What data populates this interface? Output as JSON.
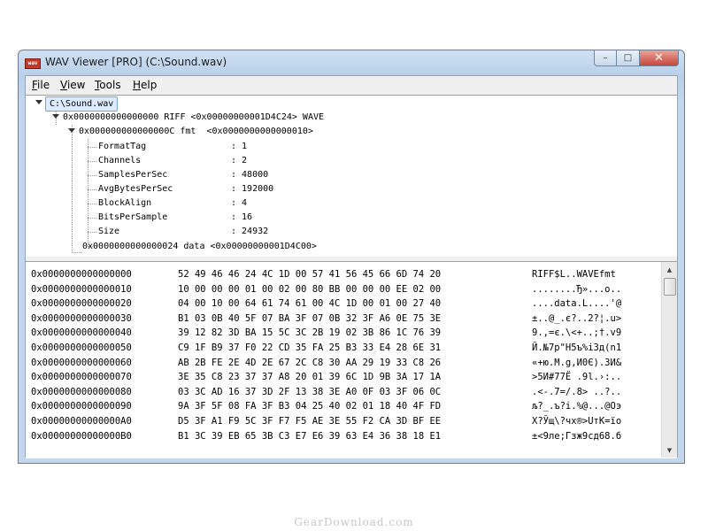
{
  "window": {
    "title": "WAV Viewer [PRO] (C:\\Sound.wav)",
    "app_icon_text": "wav",
    "controls": {
      "minimize": "–",
      "maximize": "□",
      "close": "✕"
    }
  },
  "menu": {
    "file": "File",
    "view": "View",
    "tools": "Tools",
    "help": "Help"
  },
  "tree": {
    "root": "C:\\Sound.wav",
    "riff": "0x0000000000000000 RIFF <0x00000000001D4C24> WAVE",
    "fmt": "0x000000000000000C fmt  <0x0000000000000010>",
    "fields": [
      {
        "name": "FormatTag",
        "value": ": 1"
      },
      {
        "name": "Channels",
        "value": ": 2"
      },
      {
        "name": "SamplesPerSec",
        "value": ": 48000"
      },
      {
        "name": "AvgBytesPerSec",
        "value": ": 192000"
      },
      {
        "name": "BlockAlign",
        "value": ": 4"
      },
      {
        "name": "BitsPerSample",
        "value": ": 16"
      },
      {
        "name": "Size",
        "value": ": 24932"
      }
    ],
    "data": "0x0000000000000024 data <0x00000000001D4C00>"
  },
  "hex_rows": [
    {
      "offset": "0x0000000000000000",
      "bytes": "52 49 46 46 24 4C 1D 00 57 41 56 45 66 6D 74 20",
      "ascii": "RIFF$L..WAVEfmt"
    },
    {
      "offset": "0x0000000000000010",
      "bytes": "10 00 00 00 01 00 02 00 80 BB 00 00 00 EE 02 00",
      "ascii": "........Ђ»...о.."
    },
    {
      "offset": "0x0000000000000020",
      "bytes": "04 00 10 00 64 61 74 61 00 4C 1D 00 01 00 27 40",
      "ascii": "....data.L....'@"
    },
    {
      "offset": "0x0000000000000030",
      "bytes": "B1 03 0B 40 5F 07 BA 3F 07 0B 32 3F A6 0E 75 3E",
      "ascii": "±..@_.є?..2?¦.u>"
    },
    {
      "offset": "0x0000000000000040",
      "bytes": "39 12 82 3D BA 15 5C 3C 2B 19 02 3B 86 1C 76 39",
      "ascii": "9.‚=є.\\<+..;†.v9"
    },
    {
      "offset": "0x0000000000000050",
      "bytes": "C9 1F B9 37 F0 22 CD 35 FA 25 B3 33 E4 28 6E 31",
      "ascii": "Й.№7р\"Н5ъ%і3д(n1"
    },
    {
      "offset": "0x0000000000000060",
      "bytes": "AB 2B FE 2E 4D 2E 67 2C C8 30 AA 29 19 33 C8 26",
      "ascii": "«+ю.M.g,И0Є).3И&"
    },
    {
      "offset": "0x0000000000000070",
      "bytes": "3E 35 C8 23 37 37 A8 20 01 39 6C 1D 9B 3A 17 1A",
      "ascii": ">5И#77Ё .9l.›:.."
    },
    {
      "offset": "0x0000000000000080",
      "bytes": "03 3C AD 16 37 3D 2F 13 38 3E A0 0F 03 3F 06 0C",
      "ascii": ".<-.7=/.8> ..?.."
    },
    {
      "offset": "0x0000000000000090",
      "bytes": "9A 3F 5F 08 FA 3F B3 04 25 40 02 01 18 40 4F FD",
      "ascii": "љ?_.ъ?і.%@...@Oэ"
    },
    {
      "offset": "0x00000000000000A0",
      "bytes": "D5 3F A1 F9 5C 3F F7 F5 AE 3E 55 F2 CA 3D BF EE",
      "ascii": "Х?Ўщ\\?чх®>UтК=їо"
    },
    {
      "offset": "0x00000000000000B0",
      "bytes": "B1 3C 39 EB 65 3B C3 E7 E6 39 63 E4 36 38 18 E1",
      "ascii": "±<9лe;Гзж9cд68.б"
    }
  ],
  "watermark": "GearDownload.com"
}
